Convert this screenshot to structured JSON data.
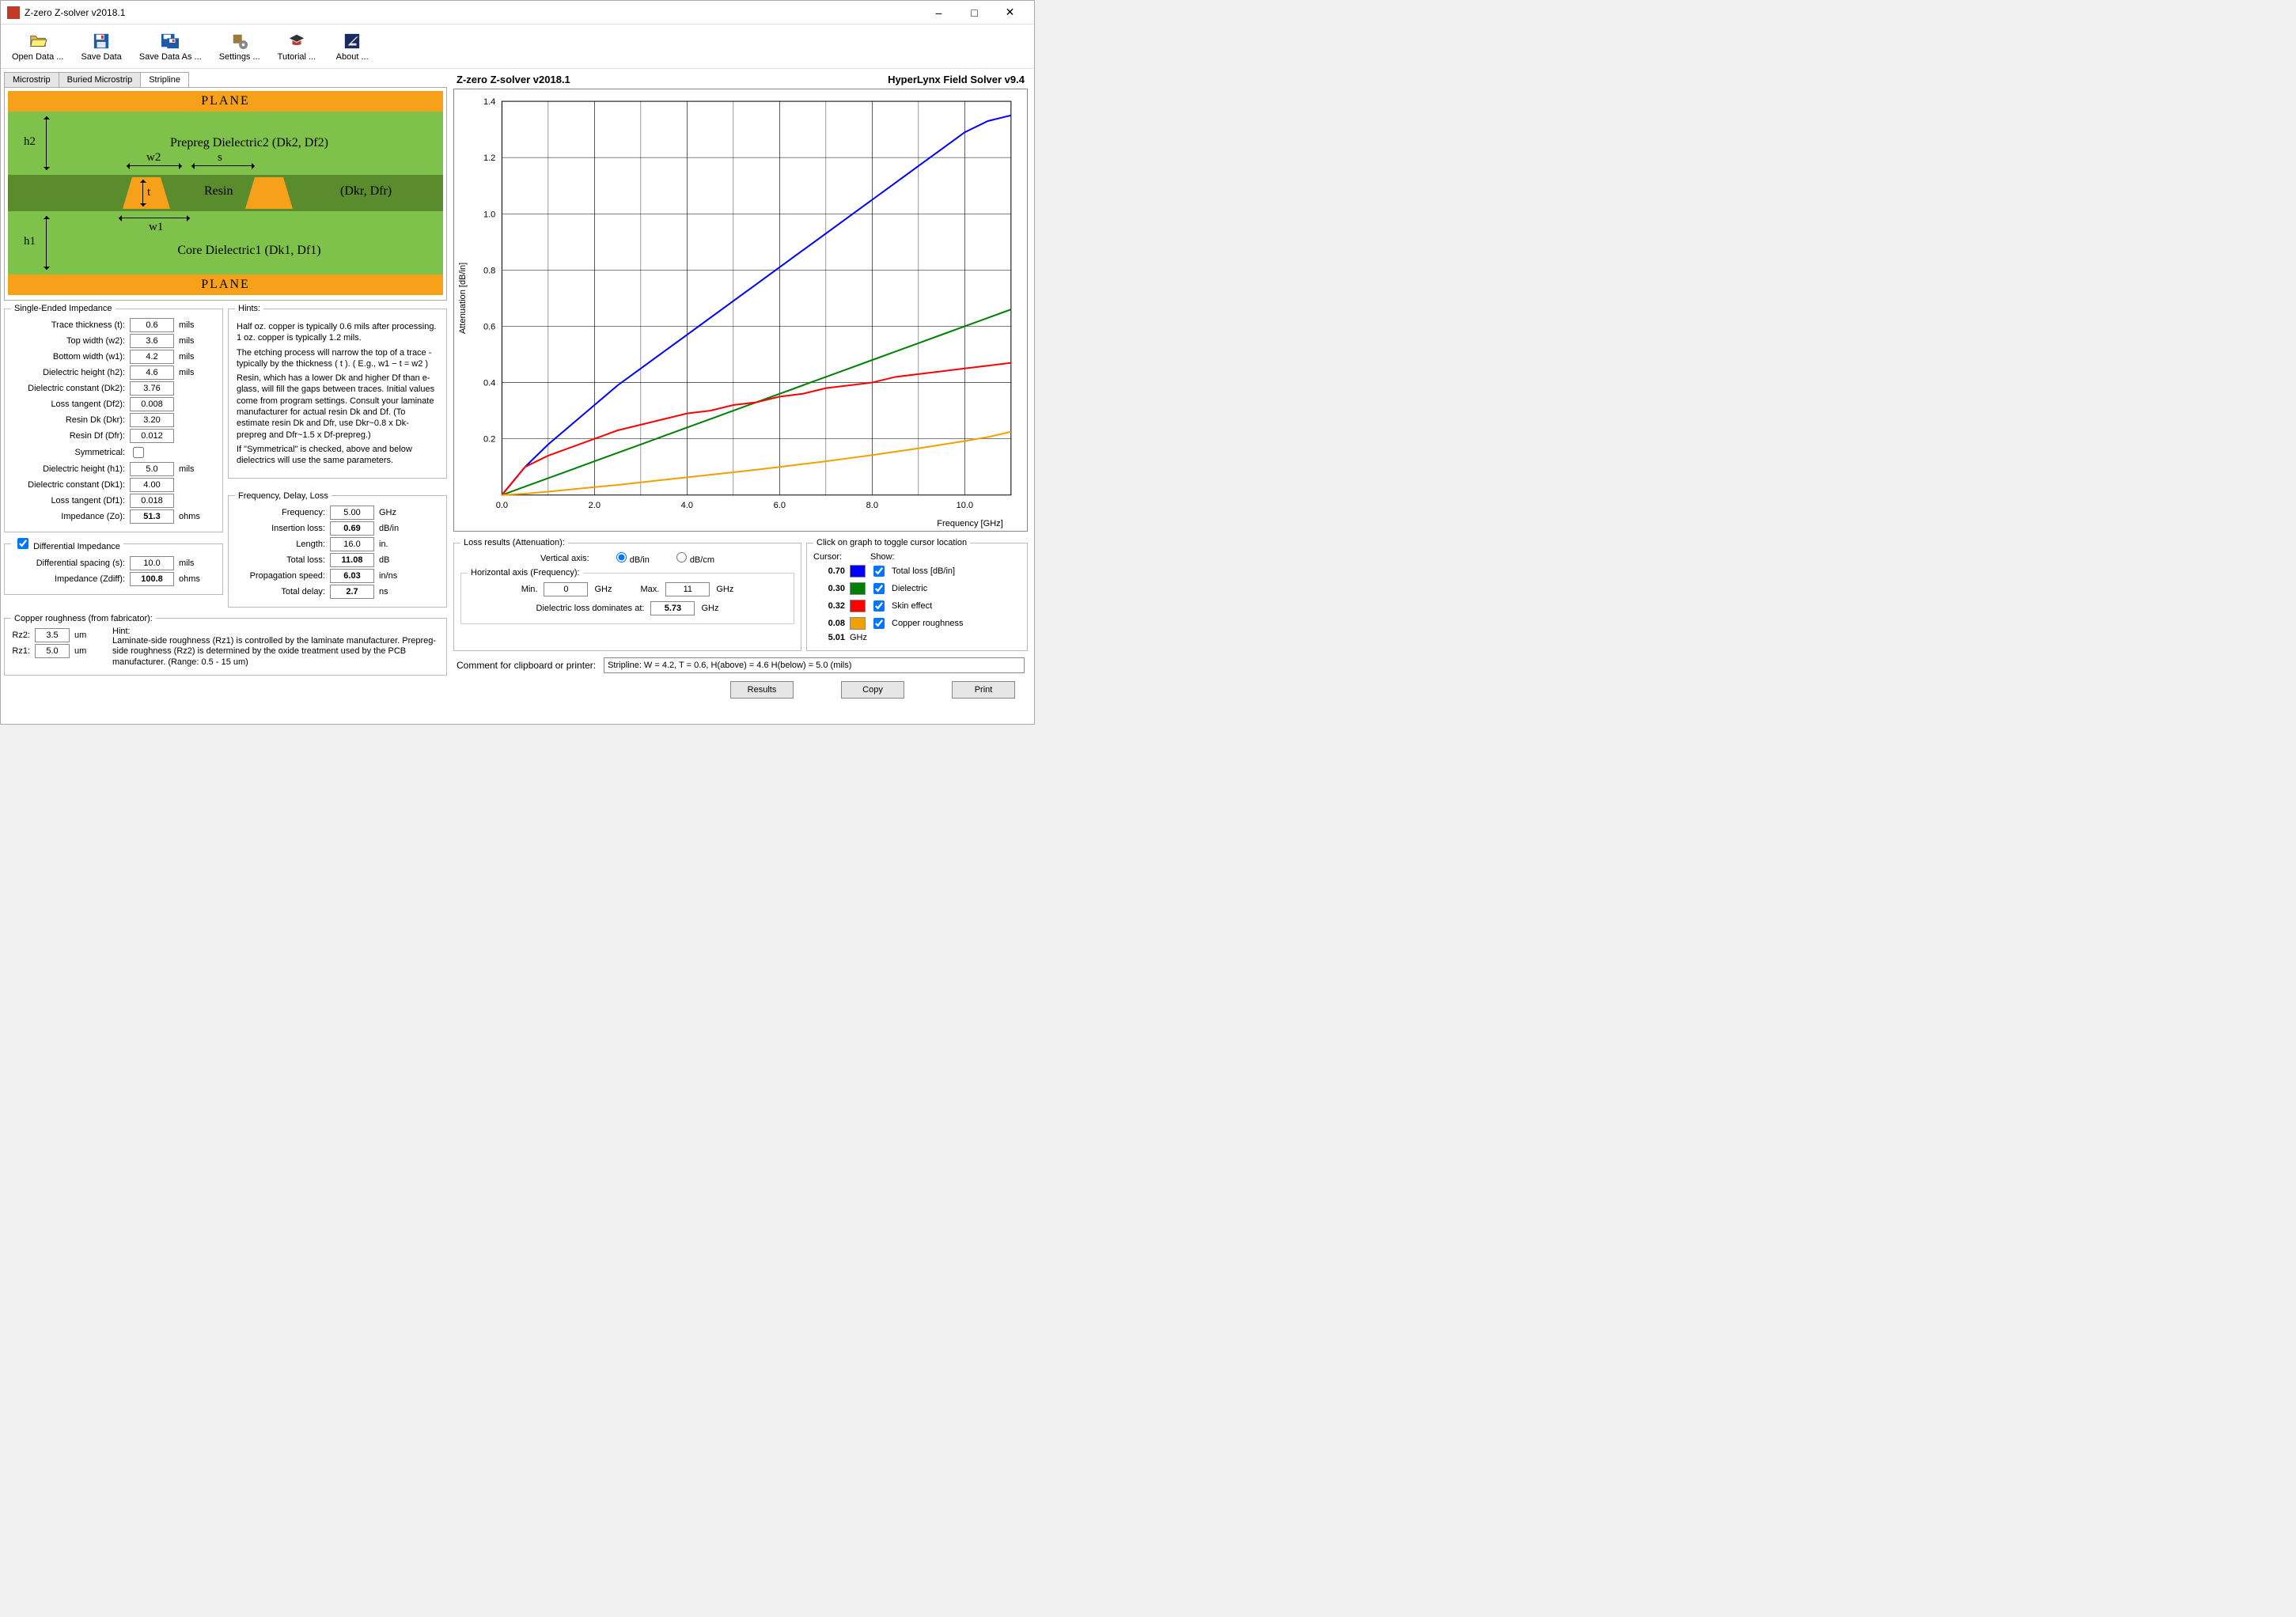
{
  "window": {
    "title": "Z-zero  Z-solver v2018.1"
  },
  "toolbar": {
    "open": "Open Data ...",
    "save": "Save Data",
    "saveas": "Save Data As ...",
    "settings": "Settings ...",
    "tutorial": "Tutorial ...",
    "about": "About ..."
  },
  "tabs": {
    "microstrip": "Microstrip",
    "buried": "Buried Microstrip",
    "stripline": "Stripline"
  },
  "xsection": {
    "plane": "PLANE",
    "prepreg": "Prepreg Dielectric2     (Dk2, Df2)",
    "core": "Core Dielectric1     (Dk1, Df1)",
    "resin": "Resin",
    "dkr": "(Dkr, Dfr)",
    "h1": "h1",
    "h2": "h2",
    "w1": "w1",
    "w2": "w2",
    "s": "s",
    "t": "t"
  },
  "single": {
    "legend": "Single-Ended Impedance",
    "t_label": "Trace thickness (t):",
    "t": "0.6",
    "t_unit": "mils",
    "w2_label": "Top width (w2):",
    "w2": "3.6",
    "w2_unit": "mils",
    "w1_label": "Bottom width (w1):",
    "w1": "4.2",
    "w1_unit": "mils",
    "h2_label": "Dielectric height (h2):",
    "h2": "4.6",
    "h2_unit": "mils",
    "dk2_label": "Dielectric constant (Dk2):",
    "dk2": "3.76",
    "df2_label": "Loss tangent (Df2):",
    "df2": "0.008",
    "dkr_label": "Resin Dk (Dkr):",
    "dkr": "3.20",
    "dfr_label": "Resin Df (Dfr):",
    "dfr": "0.012",
    "sym_label": "Symmetrical:",
    "h1_label": "Dielectric height (h1):",
    "h1": "5.0",
    "h1_unit": "mils",
    "dk1_label": "Dielectric constant (Dk1):",
    "dk1": "4.00",
    "df1_label": "Loss tangent (Df1):",
    "df1": "0.018",
    "zo_label": "Impedance (Zo):",
    "zo": "51.3",
    "zo_unit": "ohms"
  },
  "diff": {
    "check_label": "Differential Impedance",
    "s_label": "Differential spacing (s):",
    "s": "10.0",
    "s_unit": "mils",
    "z_label": "Impedance (Zdiff):",
    "z": "100.8",
    "z_unit": "ohms"
  },
  "rough": {
    "legend": "Copper roughness (from fabricator):",
    "rz2_label": "Rz2:",
    "rz2": "3.5",
    "rz2_unit": "um",
    "rz1_label": "Rz1:",
    "rz1": "5.0",
    "rz1_unit": "um",
    "hint_label": "Hint:",
    "hint": "Laminate-side roughness (Rz1) is controlled by the laminate manufacturer.  Prepreg-side roughness (Rz2) is determined by the oxide treatment used by the PCB manufacturer.   (Range: 0.5 - 15 um)"
  },
  "hints": {
    "legend": "Hints:",
    "p1": "Half oz. copper is typically 0.6 mils after processing.   1 oz. copper is typically 1.2 mils.",
    "p2": "The etching process will narrow the top of a trace - typically by the thickness ( t ).  ( E.g., w1 − t = w2 )",
    "p3": "Resin, which has a lower Dk and higher Df than e-glass, will fill the gaps between traces. Initial values come from program settings. Consult your laminate manufacturer for actual resin Dk and Df. (To estimate resin Dk and Dfr, use Dkr~0.8 x Dk-prepreg and Dfr~1.5 x Df-prepreg.)",
    "p4": "If \"Symmetrical\" is checked, above and below dielectrics will use the same parameters."
  },
  "freq": {
    "legend": "Frequency, Delay, Loss",
    "freq_label": "Frequency:",
    "freq": "5.00",
    "freq_unit": "GHz",
    "il_label": "Insertion loss:",
    "il": "0.69",
    "il_unit": "dB/in",
    "len_label": "Length:",
    "len": "16.0",
    "len_unit": "in.",
    "tl_label": "Total loss:",
    "tl": "11.08",
    "tl_unit": "dB",
    "ps_label": "Propagation speed:",
    "ps": "6.03",
    "ps_unit": "in/ns",
    "td_label": "Total delay:",
    "td": "2.7",
    "td_unit": "ns"
  },
  "right_header": {
    "center": "Z-zero  Z-solver v2018.1",
    "right": "HyperLynx Field Solver v9.4"
  },
  "chart_data": {
    "type": "line",
    "xlabel": "Frequency [GHz]",
    "ylabel": "Attenuation [dB/in]",
    "xlim": [
      0,
      11
    ],
    "ylim": [
      0,
      1.4
    ],
    "xticks": [
      0.0,
      2.0,
      4.0,
      6.0,
      8.0,
      10.0
    ],
    "yticks": [
      0.2,
      0.4,
      0.6,
      0.8,
      1.0,
      1.2,
      1.4
    ],
    "x": [
      0.0,
      0.5,
      1.0,
      1.5,
      2.0,
      2.5,
      3.0,
      3.5,
      4.0,
      4.5,
      5.0,
      5.5,
      6.0,
      6.5,
      7.0,
      7.5,
      8.0,
      8.5,
      9.0,
      9.5,
      10.0,
      10.5,
      11.0
    ],
    "series": [
      {
        "name": "Total loss [dB/in]",
        "color": "#0000ff",
        "values": [
          0.0,
          0.1,
          0.18,
          0.25,
          0.32,
          0.39,
          0.45,
          0.51,
          0.57,
          0.63,
          0.69,
          0.75,
          0.81,
          0.87,
          0.93,
          0.99,
          1.05,
          1.11,
          1.17,
          1.23,
          1.29,
          1.33,
          1.35
        ]
      },
      {
        "name": "Dielectric",
        "color": "#008000",
        "values": [
          0.0,
          0.03,
          0.06,
          0.09,
          0.12,
          0.15,
          0.18,
          0.21,
          0.24,
          0.27,
          0.3,
          0.33,
          0.36,
          0.39,
          0.42,
          0.45,
          0.48,
          0.51,
          0.54,
          0.57,
          0.6,
          0.63,
          0.66
        ]
      },
      {
        "name": "Skin effect",
        "color": "#ff0000",
        "values": [
          0.0,
          0.1,
          0.14,
          0.17,
          0.2,
          0.23,
          0.25,
          0.27,
          0.29,
          0.3,
          0.32,
          0.33,
          0.35,
          0.36,
          0.38,
          0.39,
          0.4,
          0.42,
          0.43,
          0.44,
          0.45,
          0.46,
          0.47
        ]
      },
      {
        "name": "Copper roughness",
        "color": "#f0a000",
        "values": [
          0.0,
          0.005,
          0.012,
          0.02,
          0.028,
          0.036,
          0.045,
          0.054,
          0.063,
          0.072,
          0.081,
          0.09,
          0.1,
          0.11,
          0.12,
          0.131,
          0.142,
          0.154,
          0.166,
          0.179,
          0.192,
          0.206,
          0.225
        ]
      }
    ]
  },
  "loss_results": {
    "legend": "Loss results (Attenuation):",
    "vaxis": "Vertical axis:",
    "dbin": "dB/in",
    "dbcm": "dB/cm",
    "haxis": "Horizontal axis (Frequency):",
    "min_label": "Min.",
    "min": "0",
    "min_unit": "GHz",
    "max_label": "Max.",
    "max": "11",
    "max_unit": "GHz",
    "dom_label": "Dielectric loss dominates at:",
    "dom": "5.73",
    "dom_unit": "GHz"
  },
  "legend_box": {
    "title": "Click on graph to toggle cursor location",
    "cursor": "Cursor:",
    "show": "Show:",
    "total": {
      "val": "0.70",
      "label": "Total loss [dB/in]",
      "color": "#0000ff"
    },
    "diel": {
      "val": "0.30",
      "label": "Dielectric",
      "color": "#008000"
    },
    "skin": {
      "val": "0.32",
      "label": "Skin effect",
      "color": "#ff0000"
    },
    "rough": {
      "val": "0.08",
      "label": "Copper roughness",
      "color": "#f0a000"
    },
    "freq": {
      "val": "5.01",
      "unit": "GHz"
    }
  },
  "comment": {
    "label": "Comment for clipboard or printer:",
    "value": "Stripline: W = 4.2, T = 0.6, H(above) = 4.6 H(below) = 5.0 (mils)"
  },
  "buttons": {
    "results": "Results",
    "copy": "Copy",
    "print": "Print"
  }
}
